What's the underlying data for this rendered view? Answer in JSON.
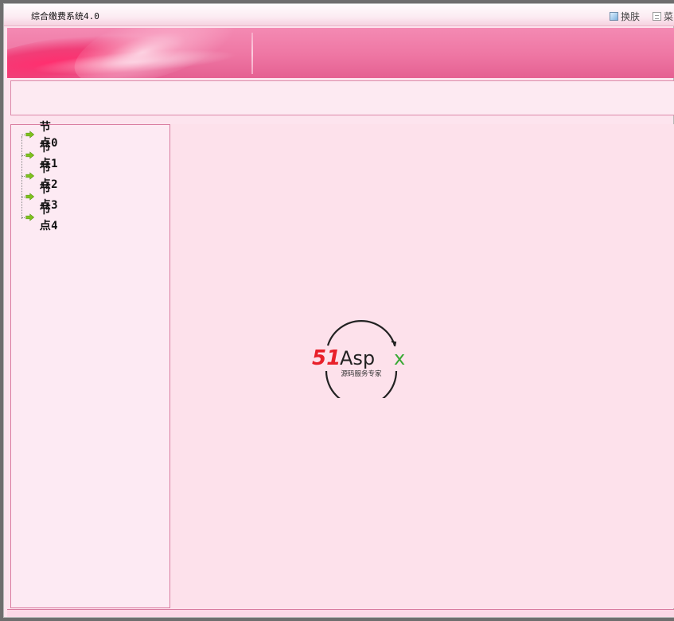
{
  "window": {
    "title": "综合缴费系统4.0",
    "buttons": [
      {
        "label": "换肤",
        "icon": "skin-icon"
      },
      {
        "label": "菜",
        "icon": "menu-icon"
      }
    ]
  },
  "tree": {
    "items": [
      {
        "label": "节点0",
        "icon": "green-arrow-icon"
      },
      {
        "label": "节点1",
        "icon": "green-arrow-icon"
      },
      {
        "label": "节点2",
        "icon": "green-arrow-icon"
      },
      {
        "label": "节点3",
        "icon": "green-arrow-icon"
      },
      {
        "label": "节点4",
        "icon": "green-arrow-icon"
      }
    ]
  },
  "logo": {
    "brand_red": "51",
    "brand_dark": "Asp",
    "brand_green": "x",
    "tagline": "源码服务专家"
  },
  "colors": {
    "accent_pink": "#ee76a3",
    "panel_bg": "#fdeaf3",
    "content_bg": "#fde1eb",
    "arrow_green": "#7fc31c",
    "logo_red": "#e8202a",
    "logo_green": "#3aa935"
  }
}
